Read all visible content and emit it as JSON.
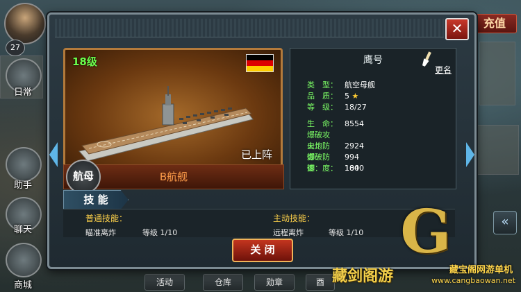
{
  "hud": {
    "recharge_label": "充值",
    "player_level": "27",
    "side_items": [
      {
        "label": "日常"
      },
      {
        "label": "助手"
      },
      {
        "label": "聊天"
      },
      {
        "label": "商城"
      }
    ],
    "bottom_tabs": [
      "活动",
      "仓库",
      "勋章",
      "酉"
    ]
  },
  "modal": {
    "close_icon": "✕",
    "ship": {
      "level": "18级",
      "flag": "germany-flag",
      "status": "已上阵",
      "class_emblem": "航母",
      "name": "B航舰"
    },
    "stats": {
      "title": "鹰号",
      "rename_label": "更名",
      "rows": [
        {
          "key": "类　型：",
          "value": "航空母舰"
        },
        {
          "key": "品　质：",
          "value": "5"
        },
        {
          "key": "等　级：",
          "value": "18/27"
        },
        {
          "key": "生　命：",
          "value": "8554"
        },
        {
          "key": "爆破攻击：",
          "value": "2924"
        },
        {
          "key": "火炮防御：",
          "value": "994"
        },
        {
          "key": "爆破防御：",
          "value": "1040"
        },
        {
          "key": "速　度：",
          "value": "180"
        }
      ]
    },
    "skills": {
      "header": "技 能",
      "normal_title": "普通技能：",
      "active_title": "主动技能：",
      "normal_skill": {
        "name": "瞄准离炸",
        "level": "等级 1/10"
      },
      "active_skill": {
        "name": "远程离炸",
        "level": "等级 1/10"
      }
    },
    "close_button": "关 闭"
  },
  "watermark": {
    "logo_letter": "G",
    "brand": "藏剑阁游",
    "site": "藏宝阁网游单机",
    "url": "www.cangbaowan.net"
  },
  "colors": {
    "accent_green": "#7dff66",
    "value_white": "#ffffff",
    "ship_name": "#ff9d4a",
    "skill_header": "#ffd24a",
    "close_red": "#c3351f"
  }
}
